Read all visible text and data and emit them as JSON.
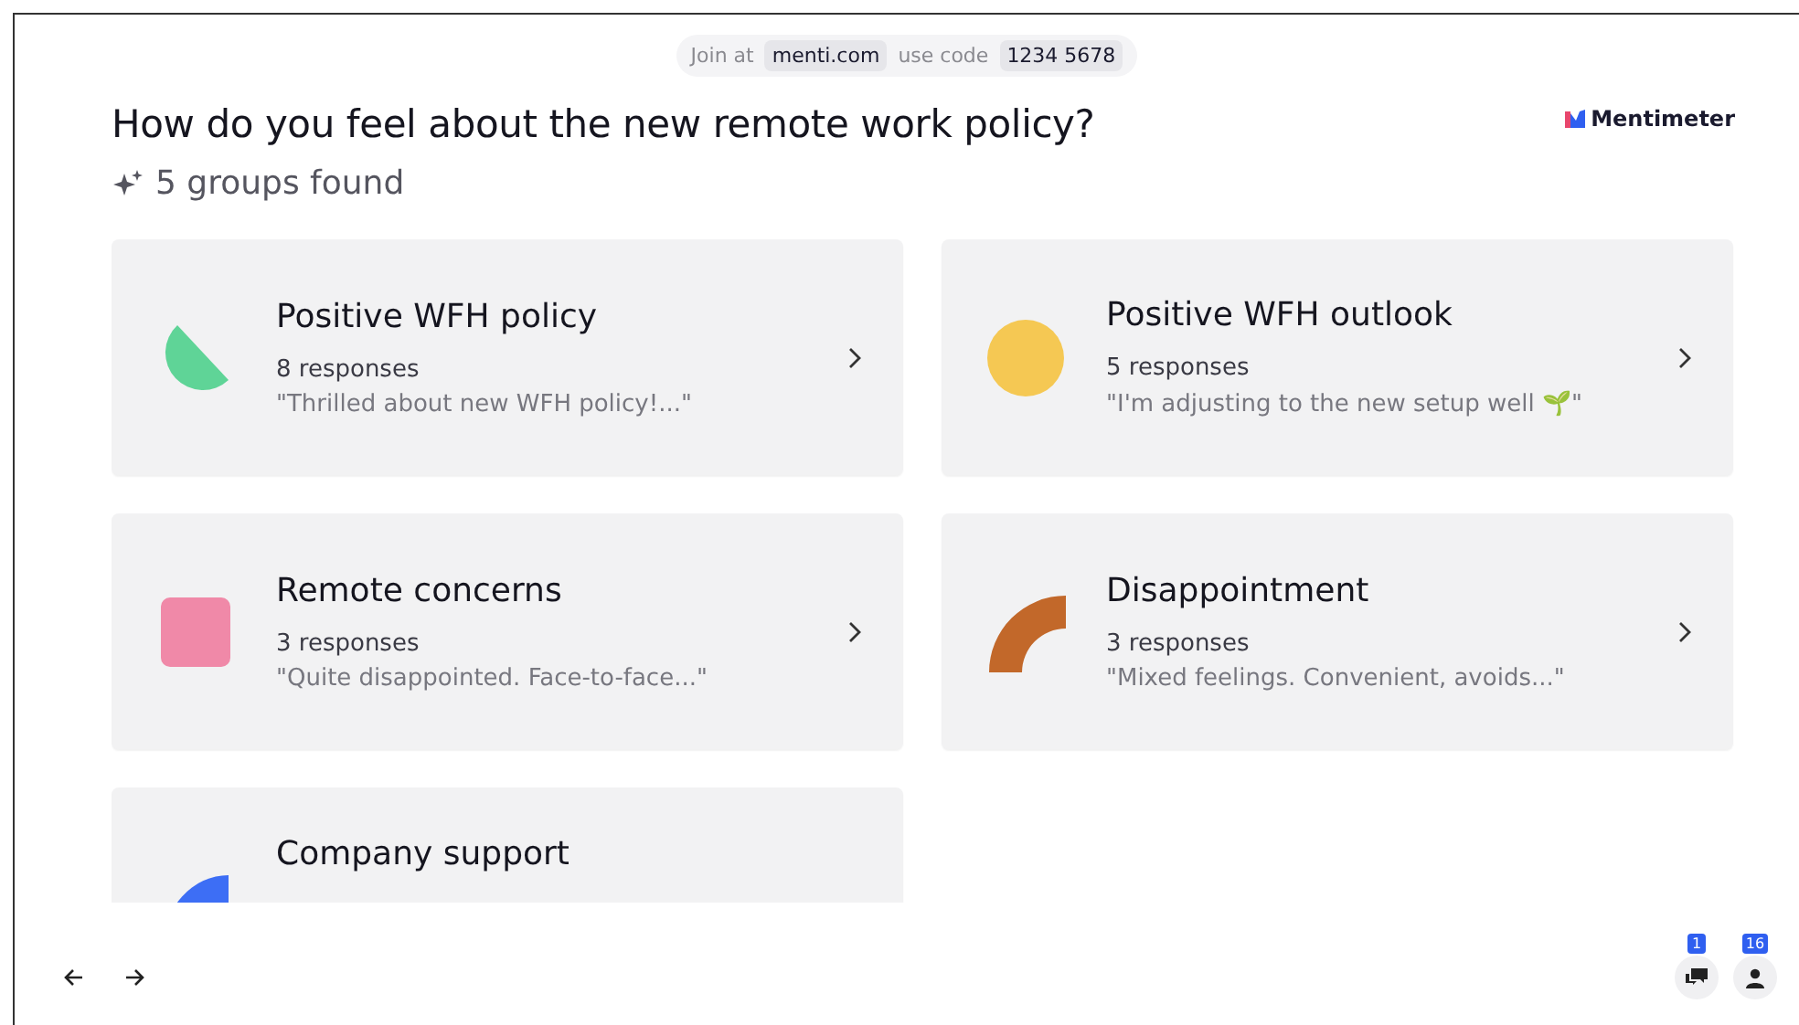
{
  "join_bar": {
    "prefix": "Join at",
    "url": "menti.com",
    "code_label": "use code",
    "code": "1234 5678"
  },
  "brand": {
    "name": "Mentimeter"
  },
  "question": {
    "title": "How do you feel about the new remote work policy?",
    "summary": "5 groups found"
  },
  "groups": [
    {
      "title": "Positive WFH policy",
      "responses": "8 responses",
      "quote": "\"Thrilled about new WFH policy!...\"",
      "kind": "half",
      "color": "#5fd497"
    },
    {
      "title": "Positive WFH outlook",
      "responses": "5 responses",
      "quote": "\"I'm adjusting to the new setup well 🌱\"",
      "kind": "circle",
      "color": "#f5c853"
    },
    {
      "title": "Remote concerns",
      "responses": "3 responses",
      "quote": "\"Quite disappointed. Face-to-face...\"",
      "kind": "square",
      "color": "#f089a8"
    },
    {
      "title": "Disappointment",
      "responses": "3 responses",
      "quote": "\"Mixed feelings. Convenient, avoids...\"",
      "kind": "arc",
      "color": "#c2682a"
    },
    {
      "title": "Company support",
      "kind": "quarter",
      "color": "#3d6ef5"
    }
  ],
  "footer": {
    "comments_badge": "1",
    "participants_badge": "16"
  }
}
